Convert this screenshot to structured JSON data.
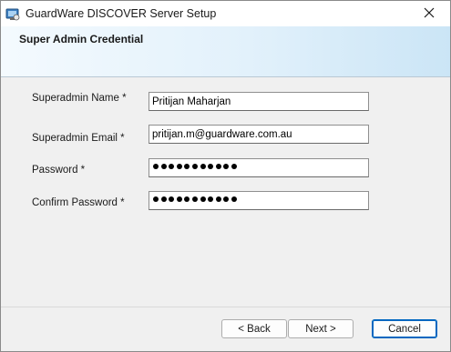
{
  "window": {
    "title": "GuardWare DISCOVER Server Setup"
  },
  "header": {
    "title": "Super Admin Credential"
  },
  "form": {
    "name_label": "Superadmin Name *",
    "name_value": "Pritijan Maharjan",
    "email_label": "Superadmin Email *",
    "email_value": "pritijan.m@guardware.com.au",
    "password_label": "Password *",
    "password_mask_length": 11,
    "confirm_label": "Confirm Password *",
    "confirm_mask_length": 11
  },
  "buttons": {
    "back": "< Back",
    "next": "Next >",
    "cancel": "Cancel"
  },
  "colors": {
    "accent": "#0067c0",
    "header_gradient_end": "#cbe5f6"
  }
}
